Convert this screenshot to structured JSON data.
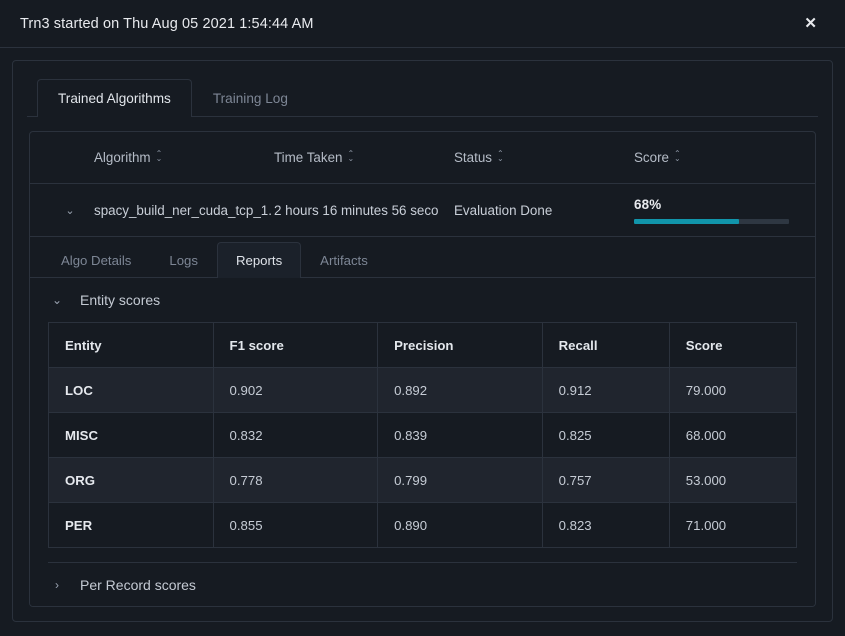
{
  "window": {
    "title": "Trn3 started on Thu Aug 05 2021 1:54:44 AM",
    "close_label": "✕"
  },
  "tabs": [
    {
      "label": "Trained Algorithms",
      "active": true
    },
    {
      "label": "Training Log",
      "active": false
    }
  ],
  "algorithms_table": {
    "columns": [
      {
        "label": "Algorithm",
        "sortable": true
      },
      {
        "label": "Time Taken",
        "sortable": true
      },
      {
        "label": "Status",
        "sortable": true
      },
      {
        "label": "Score",
        "sortable": true
      }
    ],
    "sort_icon": "sort-updown",
    "expand_caret": "⌄",
    "row": {
      "algorithm": "spacy_build_ner_cuda_tcp_1.",
      "time_taken": "2 hours 16 minutes 56 seco",
      "status": "Evaluation Done",
      "score_percent": "68%",
      "score_value": 68,
      "progress_color": "#1195ab",
      "progress_track_color": "#2e3742"
    }
  },
  "detail_tabs": [
    {
      "label": "Algo Details",
      "active": false
    },
    {
      "label": "Logs",
      "active": false
    },
    {
      "label": "Reports",
      "active": true
    },
    {
      "label": "Artifacts",
      "active": false
    }
  ],
  "accordions": [
    {
      "title": "Entity scores",
      "caret": "⌄",
      "expanded": true
    },
    {
      "title": "Per Record scores",
      "caret": "›",
      "expanded": false
    }
  ],
  "entity_scores": {
    "columns": [
      "Entity",
      "F1 score",
      "Precision",
      "Recall",
      "Score"
    ],
    "rows": [
      {
        "entity": "LOC",
        "f1": "0.902",
        "precision": "0.892",
        "recall": "0.912",
        "score": "79.000"
      },
      {
        "entity": "MISC",
        "f1": "0.832",
        "precision": "0.839",
        "recall": "0.825",
        "score": "68.000"
      },
      {
        "entity": "ORG",
        "f1": "0.778",
        "precision": "0.799",
        "recall": "0.757",
        "score": "53.000"
      },
      {
        "entity": "PER",
        "f1": "0.855",
        "precision": "0.890",
        "recall": "0.823",
        "score": "71.000"
      }
    ]
  },
  "colors": {
    "background": "#161b22",
    "row_alt": "#20252e",
    "border": "#2b323d",
    "accent": "#1195ab",
    "text_primary": "#e8eaee",
    "text_muted": "#7d8695"
  }
}
